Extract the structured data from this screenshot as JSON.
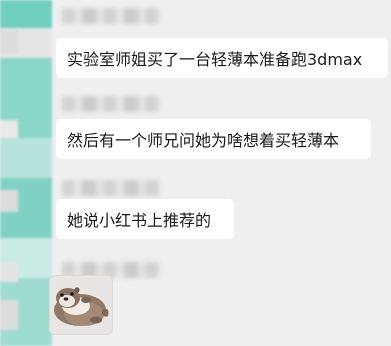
{
  "messages": [
    {
      "text": "实验室师姐买了一台轻薄本准备跑3dmax"
    },
    {
      "text": "然后有一个师兄问她为啥想着买轻薄本"
    },
    {
      "text": "她说小红书上推荐的"
    }
  ],
  "sticker": {
    "icon": "otter-sticker-icon"
  },
  "colors": {
    "background": "#efefef",
    "bubble": "#ffffff",
    "avatar_teal": "#7fd2c3",
    "text": "#1a1a1a"
  }
}
